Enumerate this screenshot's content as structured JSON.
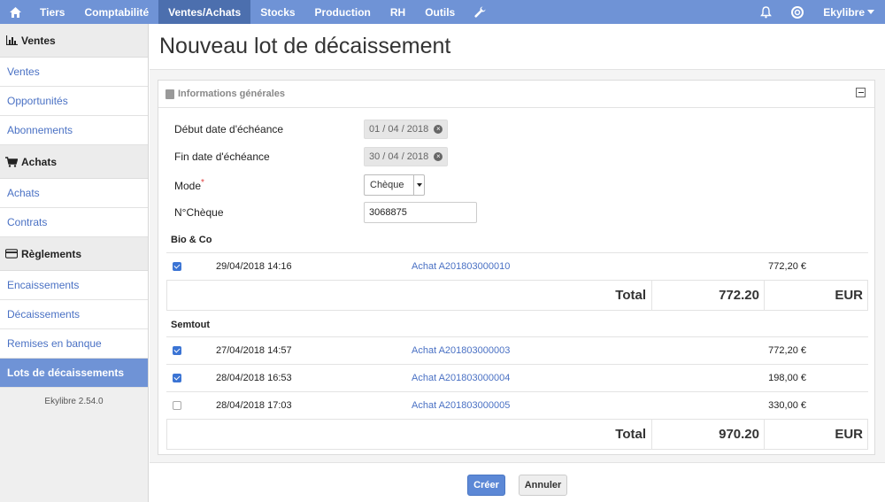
{
  "topnav": {
    "items": [
      {
        "label": "Tiers",
        "active": false
      },
      {
        "label": "Comptabilité",
        "active": false
      },
      {
        "label": "Ventes/Achats",
        "active": true
      },
      {
        "label": "Stocks",
        "active": false
      },
      {
        "label": "Production",
        "active": false
      },
      {
        "label": "RH",
        "active": false
      },
      {
        "label": "Outils",
        "active": false
      }
    ],
    "user": "Ekylibre"
  },
  "sidebar": {
    "sections": [
      {
        "title": "Ventes",
        "items": [
          "Ventes",
          "Opportunités",
          "Abonnements"
        ]
      },
      {
        "title": "Achats",
        "items": [
          "Achats",
          "Contrats"
        ]
      },
      {
        "title": "Règlements",
        "items": [
          "Encaissements",
          "Décaissements",
          "Remises en banque",
          "Lots de décaissements"
        ]
      }
    ],
    "active_item": "Lots de décaissements",
    "version": "Ekylibre 2.54.0"
  },
  "page": {
    "title": "Nouveau lot de décaissement",
    "panel_title": "Informations générales"
  },
  "form": {
    "start_label": "Début date d'échéance",
    "start_value": "01 / 04 / 2018",
    "end_label": "Fin date d'échéance",
    "end_value": "30 / 04 / 2018",
    "mode_label": "Mode",
    "mode_value": "Chèque",
    "cheque_label": "N°Chèque",
    "cheque_value": "3068875"
  },
  "groups": [
    {
      "name": "Bio & Co",
      "rows": [
        {
          "checked": true,
          "date": "29/04/2018 14:16",
          "ref": "Achat A201803000010",
          "amount": "772,20 €"
        }
      ],
      "total_label": "Total",
      "total_value": "772.20",
      "currency": "EUR"
    },
    {
      "name": "Semtout",
      "rows": [
        {
          "checked": true,
          "date": "27/04/2018 14:57",
          "ref": "Achat A201803000003",
          "amount": "772,20 €"
        },
        {
          "checked": true,
          "date": "28/04/2018 16:53",
          "ref": "Achat A201803000004",
          "amount": "198,00 €"
        },
        {
          "checked": false,
          "date": "28/04/2018 17:03",
          "ref": "Achat A201803000005",
          "amount": "330,00 €"
        }
      ],
      "total_label": "Total",
      "total_value": "970.20",
      "currency": "EUR"
    }
  ],
  "actions": {
    "create": "Créer",
    "cancel": "Annuler"
  },
  "colors": {
    "nav": "#6f93d6",
    "nav_active": "#4c6fae",
    "link": "#4a71c4",
    "checkbox": "#3b74d4"
  }
}
